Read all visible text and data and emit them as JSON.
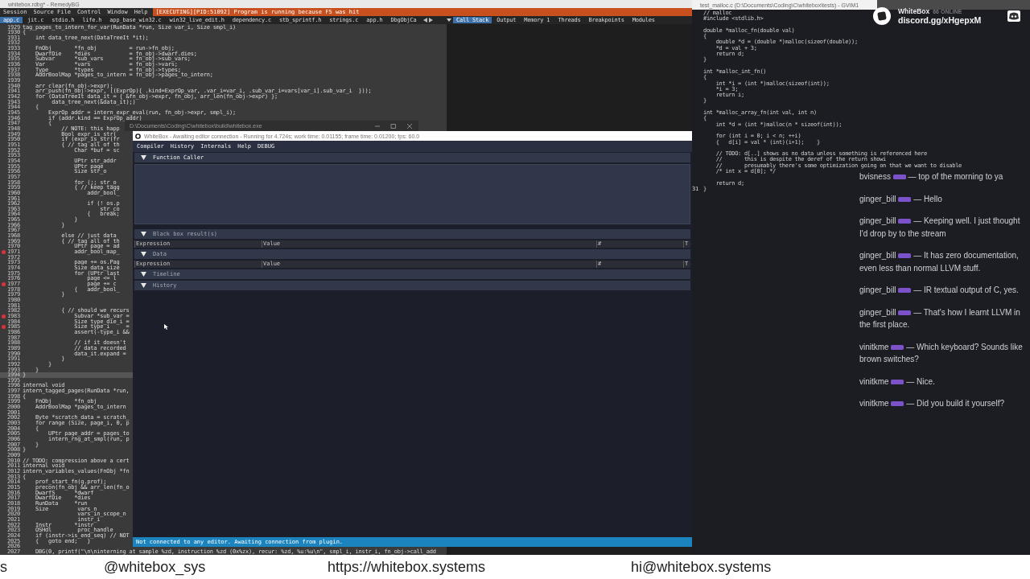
{
  "debugger": {
    "title": "whitebox.rdbg* - RemedyBG",
    "menu": [
      "Session",
      "Source File",
      "Control",
      "Window",
      "Help"
    ],
    "status": "[EXECUTING][PID:51092] Program is running because F5 was hit",
    "tabs": [
      {
        "label": "app.c",
        "selected": true
      },
      {
        "label": "jit.c",
        "selected": false
      },
      {
        "label": "stdio.h",
        "selected": false
      },
      {
        "label": "life.h",
        "selected": false
      },
      {
        "label": "app_base_win32.c",
        "selected": false
      },
      {
        "label": "win32_live_edit.h",
        "selected": false
      },
      {
        "label": "dependency.c",
        "selected": false
      },
      {
        "label": "stb_sprintf.h",
        "selected": false
      },
      {
        "label": "strings.c",
        "selected": false
      },
      {
        "label": "app.h",
        "selected": false
      },
      {
        "label": "DbgObjCa",
        "selected": false
      }
    ],
    "panel_tabs": [
      {
        "label": "Call Stack",
        "selected": true
      },
      {
        "label": "Output",
        "selected": false
      },
      {
        "label": "Memory 1",
        "selected": false
      },
      {
        "label": "Threads",
        "selected": false
      },
      {
        "label": "Breakpoints",
        "selected": false
      },
      {
        "label": "Modules",
        "selected": false
      }
    ],
    "lines": [
      {
        "number": "1929",
        "text": "tag_pages_to_intern_for_var(RunData *run, Size var_i, Size smpl_i)",
        "breakpoint": false,
        "highlighted": false
      },
      {
        "number": "1930",
        "text": "{",
        "breakpoint": false,
        "highlighted": false
      },
      {
        "number": "1931",
        "text": "    int data_tree_next(DataTreeIt *it);",
        "breakpoint": false,
        "highlighted": false
      },
      {
        "number": "1932",
        "breakpoint": false,
        "highlighted": false
      },
      {
        "number": "1933",
        "text": "    FnObj       *fn_obj          = run->fn_obj;",
        "breakpoint": false,
        "highlighted": false
      },
      {
        "number": "1934",
        "text": "    DwarfDie    *dies            = fn_obj->dwarf.dies;",
        "breakpoint": false,
        "highlighted": false
      },
      {
        "number": "1935",
        "text": "    Subvar      *sub_vars        = fn_obj->sub_vars;",
        "breakpoint": false,
        "highlighted": false
      },
      {
        "number": "1936",
        "text": "    Var         *vars            = fn_obj->vars;",
        "breakpoint": false,
        "highlighted": false
      },
      {
        "number": "1937",
        "text": "    Type        *types           = fn_obj->types;",
        "breakpoint": false,
        "highlighted": false
      },
      {
        "number": "1938",
        "text": "    AddrBoolMap *pages_to_intern = fn_obj->pages_to_intern;",
        "breakpoint": false,
        "highlighted": false
      },
      {
        "number": "1939",
        "breakpoint": false,
        "highlighted": false
      },
      {
        "number": "1940",
        "text": "    arr_clear(fn_obj->expr);",
        "breakpoint": false,
        "highlighted": false
      },
      {
        "number": "1941",
        "text": "    arr_push(fn_obj->expr, ((ExprOp){ .kind=ExprOp_var, .var_i=var_i, .sub_var_i=vars[var_i].sub_var_i  }));",
        "breakpoint": false,
        "highlighted": false
      },
      {
        "number": "1942",
        "text": "    for (DataTreeIt data_it = { &fn_obj->expr, fn_obj, arr_len(fn_obj->expr) };",
        "breakpoint": false,
        "highlighted": false
      },
      {
        "number": "1943",
        "text": "         data_tree_next(&data_it);)",
        "breakpoint": false,
        "highlighted": false
      },
      {
        "number": "1944",
        "text": "    {",
        "breakpoint": false,
        "highlighted": false
      },
      {
        "number": "1945",
        "text": "        ExprOp addr = intern_expr_eval(run, fn_obj->expr, smpl_i);",
        "breakpoint": false,
        "highlighted": false
      },
      {
        "number": "1946",
        "text": "        if (addr.kind == ExprOp_addr)",
        "breakpoint": false,
        "highlighted": false
      },
      {
        "number": "1947",
        "text": "        {",
        "breakpoint": false,
        "highlighted": false
      },
      {
        "number": "1948",
        "text": "            // NOTE: this happ",
        "breakpoint": false,
        "highlighted": false
      },
      {
        "number": "1949",
        "text": "            Bool expr_is_str(",
        "breakpoint": false,
        "highlighted": false
      },
      {
        "number": "1950",
        "text": "            if (expr_is_str(fr",
        "breakpoint": false,
        "highlighted": false
      },
      {
        "number": "1951",
        "text": "            { // tag all of th",
        "breakpoint": false,
        "highlighted": false
      },
      {
        "number": "1952",
        "text": "                Char *buf = sc",
        "breakpoint": false,
        "highlighted": false
      },
      {
        "number": "1953",
        "breakpoint": false,
        "highlighted": false
      },
      {
        "number": "1954",
        "text": "                UPtr str_addr",
        "breakpoint": false,
        "highlighted": false
      },
      {
        "number": "1955",
        "text": "                UPtr page",
        "breakpoint": false,
        "highlighted": false
      },
      {
        "number": "1956",
        "text": "                Size str_o",
        "breakpoint": false,
        "highlighted": false
      },
      {
        "number": "1957",
        "breakpoint": false,
        "highlighted": false
      },
      {
        "number": "1958",
        "text": "                for (;; str_o",
        "breakpoint": false,
        "highlighted": false
      },
      {
        "number": "1959",
        "text": "                { // keep tagg",
        "breakpoint": false,
        "highlighted": false
      },
      {
        "number": "1960",
        "text": "                    addr_bool_",
        "breakpoint": false,
        "highlighted": false
      },
      {
        "number": "1961",
        "breakpoint": false,
        "highlighted": false
      },
      {
        "number": "1962",
        "text": "                    if (! os.p",
        "breakpoint": false,
        "highlighted": false
      },
      {
        "number": "1963",
        "text": "                        str_co",
        "breakpoint": false,
        "highlighted": false
      },
      {
        "number": "1964",
        "text": "                    {   break;",
        "breakpoint": false,
        "highlighted": false
      },
      {
        "number": "1965",
        "text": "                }",
        "breakpoint": false,
        "highlighted": false
      },
      {
        "number": "1966",
        "text": "            }",
        "breakpoint": false,
        "highlighted": false
      },
      {
        "number": "1967",
        "breakpoint": false,
        "highlighted": false
      },
      {
        "number": "1968",
        "text": "            else // just data",
        "breakpoint": false,
        "highlighted": false
      },
      {
        "number": "1969",
        "text": "            { // tag all of th",
        "breakpoint": false,
        "highlighted": false
      },
      {
        "number": "1970",
        "text": "                UPtr page = ad",
        "breakpoint": false,
        "highlighted": false
      },
      {
        "number": "1971",
        "text": "                addr_bool_map_",
        "breakpoint": true,
        "highlighted": false
      },
      {
        "number": "1972",
        "breakpoint": false,
        "highlighted": false
      },
      {
        "number": "1973",
        "text": "                page += os.Pag",
        "breakpoint": false,
        "highlighted": false
      },
      {
        "number": "1974",
        "text": "                Size data_size",
        "breakpoint": false,
        "highlighted": false
      },
      {
        "number": "1975",
        "text": "                for (UPtr last",
        "breakpoint": false,
        "highlighted": false
      },
      {
        "number": "1976",
        "text": "                    page <= l",
        "breakpoint": false,
        "highlighted": false
      },
      {
        "number": "1977",
        "text": "                    page += c",
        "breakpoint": true,
        "highlighted": false
      },
      {
        "number": "1978",
        "text": "                {   addr_bool_",
        "breakpoint": false,
        "highlighted": false
      },
      {
        "number": "1979",
        "text": "            }",
        "breakpoint": false,
        "highlighted": false
      },
      {
        "number": "1980",
        "breakpoint": false,
        "highlighted": false
      },
      {
        "number": "1981",
        "breakpoint": false,
        "highlighted": false
      },
      {
        "number": "1982",
        "text": "            { // should we recurs",
        "breakpoint": false,
        "highlighted": false
      },
      {
        "number": "1983",
        "text": "                Subvar *sub_var =",
        "breakpoint": true,
        "highlighted": false
      },
      {
        "number": "1984",
        "text": "                Size type_die_i =",
        "breakpoint": false,
        "highlighted": false
      },
      {
        "number": "1985",
        "text": "                Size type_i     =",
        "breakpoint": true,
        "highlighted": false
      },
      {
        "number": "1986",
        "text": "                assert(-type_i &&",
        "breakpoint": false,
        "highlighted": false
      },
      {
        "number": "1987",
        "breakpoint": false,
        "highlighted": false
      },
      {
        "number": "1988",
        "text": "                // if it doesn't",
        "breakpoint": false,
        "highlighted": false
      },
      {
        "number": "1989",
        "text": "                // data recorded",
        "breakpoint": false,
        "highlighted": false
      },
      {
        "number": "1990",
        "text": "                data_it.expand =",
        "breakpoint": false,
        "highlighted": false
      },
      {
        "number": "1991",
        "text": "            }",
        "breakpoint": false,
        "highlighted": false
      },
      {
        "number": "1992",
        "text": "        }",
        "breakpoint": false,
        "highlighted": false
      },
      {
        "number": "1993",
        "text": "    }",
        "breakpoint": false,
        "highlighted": false
      },
      {
        "number": "1994",
        "text": "}",
        "breakpoint": false,
        "highlighted": true
      },
      {
        "number": "1995",
        "breakpoint": false,
        "highlighted": false
      },
      {
        "number": "1996",
        "text": "internal void",
        "breakpoint": false,
        "highlighted": false
      },
      {
        "number": "1997",
        "text": "intern_tagged_pages(RunData *run,",
        "breakpoint": false,
        "highlighted": false
      },
      {
        "number": "1998",
        "text": "{",
        "breakpoint": false,
        "highlighted": false
      },
      {
        "number": "1999",
        "text": "    FnObj       *fn_obj",
        "breakpoint": false,
        "highlighted": false
      },
      {
        "number": "2000",
        "text": "    AddrBoolMap *pages_to_intern",
        "breakpoint": false,
        "highlighted": false
      },
      {
        "number": "2001",
        "breakpoint": false,
        "highlighted": false
      },
      {
        "number": "2002",
        "text": "    Byte *scratch_data = scratch_",
        "breakpoint": false,
        "highlighted": false
      },
      {
        "number": "2003",
        "text": "    for range (Size, page_i, 0, p",
        "breakpoint": false,
        "highlighted": false
      },
      {
        "number": "2004",
        "text": "    {",
        "breakpoint": false,
        "highlighted": false
      },
      {
        "number": "2005",
        "text": "        UPtr page_addr = pages_to",
        "breakpoint": false,
        "highlighted": false
      },
      {
        "number": "2006",
        "text": "        intern_rng_at_smpl(run, p",
        "breakpoint": false,
        "highlighted": false
      },
      {
        "number": "2007",
        "text": "    }",
        "breakpoint": false,
        "highlighted": false
      },
      {
        "number": "2008",
        "text": "}",
        "breakpoint": false,
        "highlighted": false
      },
      {
        "number": "2009",
        "breakpoint": false,
        "highlighted": false
      },
      {
        "number": "2010",
        "text": "// TODO: compression above a cert",
        "breakpoint": false,
        "highlighted": false
      },
      {
        "number": "2011",
        "text": "internal void",
        "breakpoint": false,
        "highlighted": false
      },
      {
        "number": "2012",
        "text": "intern_variables_values(FnObj *fn",
        "breakpoint": false,
        "highlighted": false
      },
      {
        "number": "2013",
        "text": "{",
        "breakpoint": false,
        "highlighted": false
      },
      {
        "number": "2014",
        "text": "    prof_start_fn(g.prof);",
        "breakpoint": false,
        "highlighted": false
      },
      {
        "number": "2015",
        "text": "    precon(fn_obj && arr_len(fn_o",
        "breakpoint": false,
        "highlighted": false
      },
      {
        "number": "2016",
        "text": "    DwarfS      *dwarf",
        "breakpoint": false,
        "highlighted": false
      },
      {
        "number": "2017",
        "text": "    DwarfDie    *dies",
        "breakpoint": false,
        "highlighted": false
      },
      {
        "number": "2018",
        "text": "    RunData     *run",
        "breakpoint": false,
        "highlighted": false
      },
      {
        "number": "2019",
        "text": "    Size         vars_n",
        "breakpoint": false,
        "highlighted": false
      },
      {
        "number": "2020",
        "text": "                 vars_in_scope_n",
        "breakpoint": false,
        "highlighted": false
      },
      {
        "number": "2021",
        "text": "                 instr_i",
        "breakpoint": false,
        "highlighted": false
      },
      {
        "number": "2022",
        "text": "    Instr       *instr",
        "breakpoint": false,
        "highlighted": false
      },
      {
        "number": "2023",
        "text": "    OSHdl        proc_handle",
        "breakpoint": false,
        "highlighted": false
      },
      {
        "number": "2024",
        "text": "    if (instr->is_end_seq) // NOT",
        "breakpoint": false,
        "highlighted": false
      },
      {
        "number": "2025",
        "text": "    {   goto end;   }",
        "breakpoint": false,
        "highlighted": false
      },
      {
        "number": "2026",
        "breakpoint": false,
        "highlighted": false
      },
      {
        "number": "2027",
        "text": "    DBG(0, printf(\"\\n\\ninterning at sample %zd, instruction %zd (0x%zx), recur: %zd, %u:%u\\n\", smpl_i, instr_i, fn_obj->call_add",
        "breakpoint": false,
        "highlighted": false
      }
    ]
  },
  "whitebox": {
    "console_title": "D:\\Documents\\Coding\\C\\whitebox\\build\\whitebox.exe",
    "title": "WhiteBox - Awaiting editor connection - Running for 4.724s; work time: 0.01155; frame time: 0.01200; fps: 60.0",
    "menu": [
      "Compiler",
      "History",
      "Internals",
      "Help",
      "DEBUG"
    ],
    "sections": [
      {
        "kind": "header",
        "title": "Function Caller",
        "expanded": true,
        "dimmed": false
      },
      {
        "kind": "panel"
      },
      {
        "kind": "header",
        "title": "Black box result(s)",
        "expanded": true,
        "dimmed": true
      },
      {
        "kind": "columns",
        "columns": [
          "Expression",
          "Value",
          "#",
          "T"
        ]
      },
      {
        "kind": "header",
        "title": "Data",
        "expanded": true,
        "dimmed": true
      },
      {
        "kind": "columns",
        "columns": [
          "Expression",
          "Value",
          "#",
          "T"
        ]
      },
      {
        "kind": "header",
        "title": "Timeline",
        "expanded": true,
        "dimmed": true
      },
      {
        "kind": "header",
        "title": "History",
        "expanded": true,
        "dimmed": true
      }
    ],
    "status": "Not connected to any editor. Awaiting connection from plugin."
  },
  "editor": {
    "title": "test_malloc.c (D:\\Documents\\Coding\\C\\whitebox\\tests) - GVIM1",
    "current_line": "31",
    "lines": [
      {
        "text": "// malloc"
      },
      {
        "text": "#include <stdlib.h>"
      },
      {
        "blank": true
      },
      {
        "text": "double *malloc_fn(double val)"
      },
      {
        "text": "{"
      },
      {
        "text": "    double *d = (double *)malloc(sizeof(double));"
      },
      {
        "text": "    *d = val + 3;"
      },
      {
        "text": "    return d;"
      },
      {
        "text": "}"
      },
      {
        "blank": true
      },
      {
        "text": "int *malloc_int_fn()"
      },
      {
        "text": "{"
      },
      {
        "text": "    int *i = (int *)malloc(sizeof(int));"
      },
      {
        "text": "    *i = 3;"
      },
      {
        "text": "    return i;"
      },
      {
        "text": "}"
      },
      {
        "blank": true
      },
      {
        "text": "int *malloc_array_fn(int val, int n)"
      },
      {
        "text": "{"
      },
      {
        "text": "    int *d = (int *)malloc(n * sizeof(int));"
      },
      {
        "blank": true
      },
      {
        "text": "    for (int i = 0; i < n; ++i)"
      },
      {
        "text": "    {   d[i] = val * (int)(i+1);    }"
      },
      {
        "blank": true
      },
      {
        "text": "    // TODO: d[..] shows as no data unless something is referenced here"
      },
      {
        "text": "    //       this is despite the deref of the return showi"
      },
      {
        "text": "    //       presumably there's some optimization going on that we want to disable"
      },
      {
        "text": "    /* int x = d[0]; */"
      },
      {
        "blank": true
      },
      {
        "text": "    return d;"
      },
      {
        "text": "}"
      }
    ]
  },
  "overlay": {
    "name": "WhiteBox",
    "online": "66 ONLINE",
    "invite": "discord.gg/xHgepxM"
  },
  "chat": [
    {
      "user": "bvisness",
      "text": "— top of the morning to ya"
    },
    {
      "user": "ginger_bill",
      "text": "— Hello"
    },
    {
      "user": "ginger_bill",
      "text": "— Keeping well. I just thought I'd drop by to the stream"
    },
    {
      "user": "ginger_bill",
      "text": "— It has zero documentation, even less than normal LLVM stuff."
    },
    {
      "user": "ginger_bill",
      "text": "— IR textual output of C, yes."
    },
    {
      "user": "ginger_bill",
      "text": "— That's how I learnt LLVM in the first place."
    },
    {
      "user": "vinitkme",
      "text": "— Which keyboard? Sounds like brown switches?"
    },
    {
      "user": "vinitkme",
      "text": "— Nice."
    },
    {
      "user": "vinitkme",
      "text": "— Did you build it yourself?"
    }
  ],
  "banner": [
    "s",
    "@whitebox_sys",
    "https://whitebox.systems",
    "hi@whitebox.systems"
  ]
}
